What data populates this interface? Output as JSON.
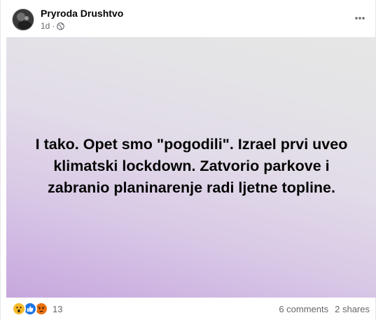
{
  "post": {
    "author": "Pryroda Drushtvo",
    "time": "1d",
    "meta_separator": "·",
    "privacy_icon": "globe-icon",
    "more_icon": "more-horizontal-icon",
    "text": "I tako. Opet smo \"pogodili\". Izrael prvi uveo klimatski lockdown. Zatvorio parkove i zabranio planinarenje radi ljetne topline.",
    "background_colors": [
      "#c7a7de",
      "#e6e6e6"
    ]
  },
  "footer": {
    "reaction_icons": [
      "wow-reaction-icon",
      "like-reaction-icon",
      "angry-reaction-icon"
    ],
    "reaction_count": "13",
    "comments": "6 comments",
    "shares": "2 shares"
  },
  "colors": {
    "secondary_text": "#65676b",
    "primary_text": "#050505",
    "like_blue": "#1b74e4"
  }
}
